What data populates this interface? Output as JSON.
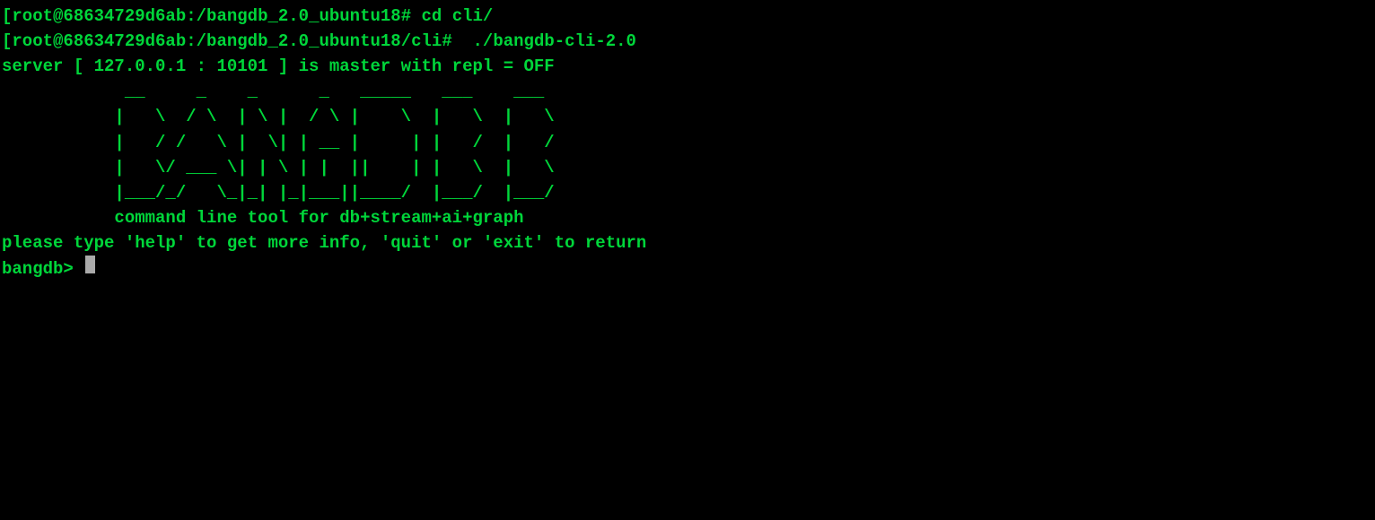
{
  "line1": {
    "bracket": "[",
    "userHost": "root@68634729d6ab",
    "colon": ":",
    "path": "/bangdb_2.0_ubuntu18",
    "hash": "# ",
    "command": "cd cli/"
  },
  "line2": {
    "bracket": "[",
    "userHost": "root@68634729d6ab",
    "colon": ":",
    "path": "/bangdb_2.0_ubuntu18/cli",
    "hash": "#  ",
    "command": "./bangdb-cli-2.0"
  },
  "serverInfo": "server [ 127.0.0.1 : 10101 ] is master with repl = OFF",
  "blank1": "",
  "ascii1": "            __     _    _      _   _____   ___    ___",
  "ascii2": "           |   \\  / \\  | \\ |  / \\ |    \\  |   \\  |   \\",
  "ascii3": "           |   / /   \\ |  \\| | __ |     | |   /  |   /",
  "ascii4": "           |   \\/ ___ \\| | \\ | |  ||    | |   \\  |   \\",
  "ascii5": "           |___/_/   \\_|_| |_|___||____/  |___/  |___/",
  "blank2": "",
  "tagline": "           command line tool for db+stream+ai+graph",
  "blank3": "",
  "helpText": "please type 'help' to get more info, 'quit' or 'exit' to return",
  "blank4": "",
  "promptText": "bangdb> "
}
